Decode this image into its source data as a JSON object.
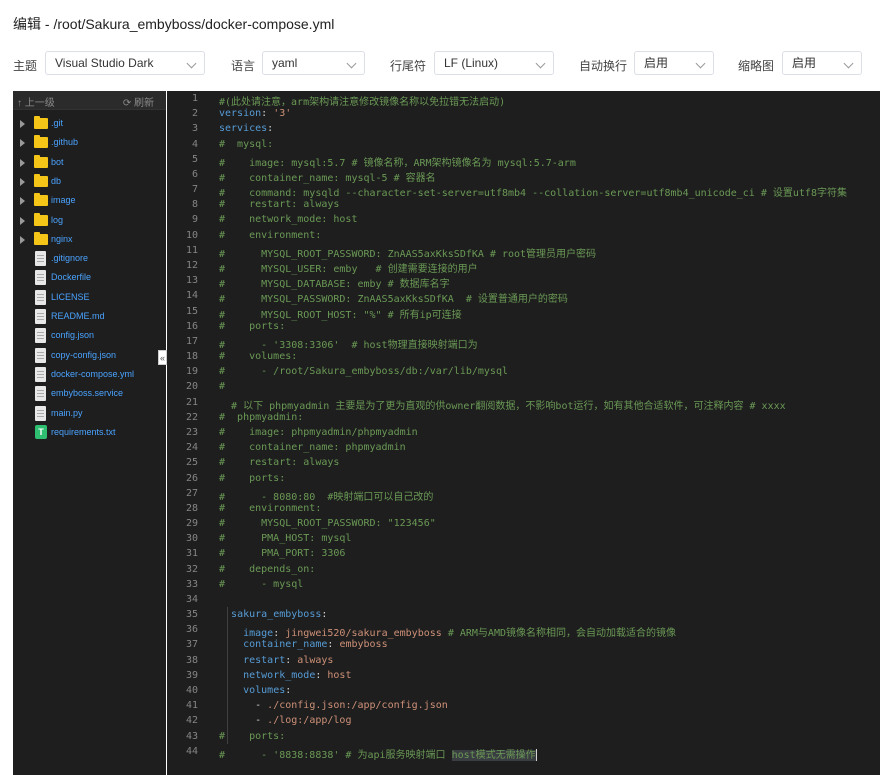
{
  "title": "编辑 - /root/Sakura_embyboss/docker-compose.yml",
  "toolbar": {
    "theme_label": "主题",
    "theme_value": "Visual Studio Dark",
    "lang_label": "语言",
    "lang_value": "yaml",
    "eol_label": "行尾符",
    "eol_value": "LF (Linux)",
    "wrap_label": "自动换行",
    "wrap_value": "启用",
    "minimap_label": "缩略图",
    "minimap_value": "启用"
  },
  "sidebar": {
    "up_label": "↑ 上一级",
    "refresh_label": "⟳ 刷新",
    "items": [
      {
        "name": ".git",
        "type": "folder"
      },
      {
        "name": ".github",
        "type": "folder"
      },
      {
        "name": "bot",
        "type": "folder"
      },
      {
        "name": "db",
        "type": "folder"
      },
      {
        "name": "image",
        "type": "folder"
      },
      {
        "name": "log",
        "type": "folder"
      },
      {
        "name": "nginx",
        "type": "folder"
      },
      {
        "name": ".gitignore",
        "type": "file"
      },
      {
        "name": "Dockerfile",
        "type": "file"
      },
      {
        "name": "LICENSE",
        "type": "file"
      },
      {
        "name": "README.md",
        "type": "file"
      },
      {
        "name": "config.json",
        "type": "file"
      },
      {
        "name": "copy-config.json",
        "type": "file"
      },
      {
        "name": "docker-compose.yml",
        "type": "file"
      },
      {
        "name": "embyboss.service",
        "type": "file"
      },
      {
        "name": "main.py",
        "type": "file"
      },
      {
        "name": "requirements.txt",
        "type": "txt"
      }
    ],
    "collapse_label": "«"
  },
  "code": [
    [
      [
        "c",
        "#(此处请注意，arm架构请注意修改镜像名称以免拉错无法启动)"
      ]
    ],
    [
      [
        "k",
        "version"
      ],
      [
        "p",
        ": "
      ],
      [
        "s",
        "'3'"
      ]
    ],
    [
      [
        "k",
        "services"
      ],
      [
        "p",
        ":"
      ]
    ],
    [
      [
        "c",
        "#  mysql:"
      ]
    ],
    [
      [
        "c",
        "#    image: mysql:5.7 # 镜像名称，ARM架构镜像名为 mysql:5.7-arm"
      ]
    ],
    [
      [
        "c",
        "#    container_name: mysql-5 # 容器名"
      ]
    ],
    [
      [
        "c",
        "#    command: mysqld --character-set-server=utf8mb4 --collation-server=utf8mb4_unicode_ci # 设置utf8字符集"
      ]
    ],
    [
      [
        "c",
        "#    restart: always"
      ]
    ],
    [
      [
        "c",
        "#    network_mode: host"
      ]
    ],
    [
      [
        "c",
        "#    environment:"
      ]
    ],
    [
      [
        "c",
        "#      MYSQL_ROOT_PASSWORD: ZnAAS5axKksSDfKA # root管理员用户密码"
      ]
    ],
    [
      [
        "c",
        "#      MYSQL_USER: emby   # 创建需要连接的用户"
      ]
    ],
    [
      [
        "c",
        "#      MYSQL_DATABASE: emby # 数据库名字"
      ]
    ],
    [
      [
        "c",
        "#      MYSQL_PASSWORD: ZnAAS5axKksSDfKA  # 设置普通用户的密码"
      ]
    ],
    [
      [
        "c",
        "#      MYSQL_ROOT_HOST: \"%\" # 所有ip可连接"
      ]
    ],
    [
      [
        "c",
        "#    ports:"
      ]
    ],
    [
      [
        "c",
        "#      - '3308:3306'  # host物理直接映射端口为"
      ]
    ],
    [
      [
        "c",
        "#    volumes:"
      ]
    ],
    [
      [
        "c",
        "#      - /root/Sakura_embyboss/db:/var/lib/mysql"
      ]
    ],
    [
      [
        "c",
        "#"
      ]
    ],
    [
      [
        "c",
        "  # 以下 phpmyadmin 主要是为了更为直观的供owner翻阅数据，不影响bot运行，如有其他合适软件，可注释内容 # xxxx"
      ]
    ],
    [
      [
        "c",
        "#  phpmyadmin:"
      ]
    ],
    [
      [
        "c",
        "#    image: phpmyadmin/phpmyadmin"
      ]
    ],
    [
      [
        "c",
        "#    container_name: phpmyadmin"
      ]
    ],
    [
      [
        "c",
        "#    restart: always"
      ]
    ],
    [
      [
        "c",
        "#    ports:"
      ]
    ],
    [
      [
        "c",
        "#      - 8080:80  #映射端口可以自己改的"
      ]
    ],
    [
      [
        "c",
        "#    environment:"
      ]
    ],
    [
      [
        "c",
        "#      MYSQL_ROOT_PASSWORD: \"123456\""
      ]
    ],
    [
      [
        "c",
        "#      PMA_HOST: mysql"
      ]
    ],
    [
      [
        "c",
        "#      PMA_PORT: 3306"
      ]
    ],
    [
      [
        "c",
        "#    depends_on:"
      ]
    ],
    [
      [
        "c",
        "#      - mysql"
      ]
    ],
    [
      [
        "p",
        ""
      ]
    ],
    [
      [
        "p",
        "  "
      ],
      [
        "k",
        "sakura_embyboss"
      ],
      [
        "p",
        ":"
      ]
    ],
    [
      [
        "p",
        "    "
      ],
      [
        "k",
        "image"
      ],
      [
        "p",
        ": "
      ],
      [
        "s",
        "jingwei520/sakura_embyboss"
      ],
      [
        "c",
        " # ARM与AMD镜像名称相同，会自动加载适合的镜像"
      ]
    ],
    [
      [
        "p",
        "    "
      ],
      [
        "k",
        "container_name"
      ],
      [
        "p",
        ": "
      ],
      [
        "s",
        "embyboss"
      ]
    ],
    [
      [
        "p",
        "    "
      ],
      [
        "k",
        "restart"
      ],
      [
        "p",
        ": "
      ],
      [
        "s",
        "always"
      ]
    ],
    [
      [
        "p",
        "    "
      ],
      [
        "k",
        "network_mode"
      ],
      [
        "p",
        ": "
      ],
      [
        "s",
        "host"
      ]
    ],
    [
      [
        "p",
        "    "
      ],
      [
        "k",
        "volumes"
      ],
      [
        "p",
        ":"
      ]
    ],
    [
      [
        "p",
        "      - "
      ],
      [
        "s",
        "./config.json:/app/config.json"
      ]
    ],
    [
      [
        "p",
        "      - "
      ],
      [
        "s",
        "./log:/app/log"
      ]
    ],
    [
      [
        "c",
        "#    ports:"
      ]
    ],
    [
      [
        "c",
        "#      - '8838:8838' # 为api服务映射端口 "
      ],
      [
        "h",
        "host模式无需操作"
      ]
    ]
  ],
  "current_line": 44
}
